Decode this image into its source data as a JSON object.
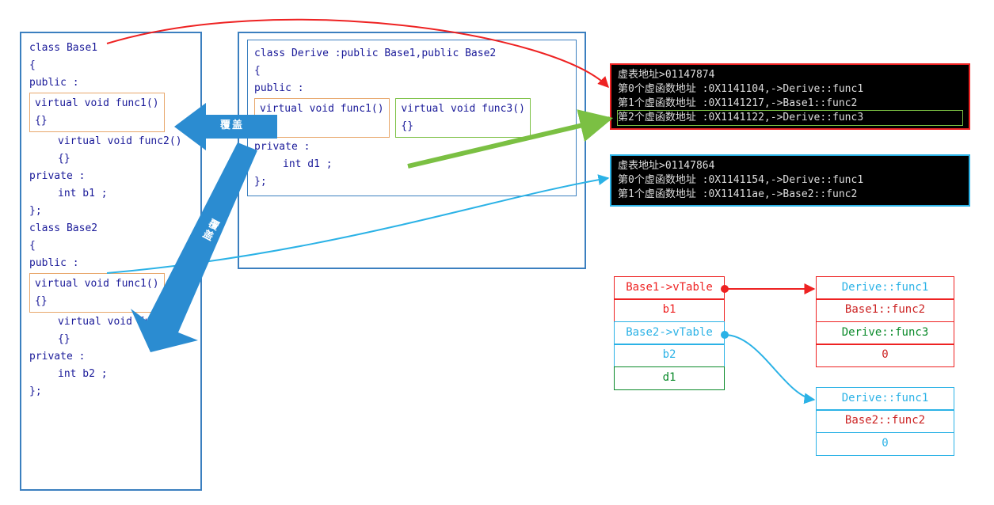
{
  "base_box": {
    "line1": "class Base1",
    "line2": "{",
    "line3": "public :",
    "func1": "virtual void func1()",
    "brace_pair": "{}",
    "func2": "virtual void func2()",
    "line_priv": "private :",
    "member_b1": "int b1 ;",
    "close": "};",
    "line_b2": "class Base2",
    "func1b": "virtual void func1()",
    "func2b": "virtual void func2()",
    "member_b2": "int b2 ;"
  },
  "derive_box": {
    "line1": "class Derive :public Base1,public Base2",
    "line2": "{",
    "line3": "public :",
    "func1": "virtual void func1()",
    "func3": "virtual void func3()",
    "brace_pair": "{}",
    "line_priv": "private :",
    "member_d1": "int d1 ;",
    "close": "};"
  },
  "console1": {
    "l1": "虚表地址>01147874",
    "l2": "第0个虚函数地址 :0X1141104,->Derive::func1",
    "l3": "第1个虚函数地址 :0X1141217,->Base1::func2",
    "l4": "第2个虚函数地址 :0X1141122,->Derive::func3"
  },
  "console2": {
    "l1": "虚表地址>01147864",
    "l2": "第0个虚函数地址 :0X1141154,->Derive::func1",
    "l3": "第1个虚函数地址 :0X11411ae,->Base2::func2"
  },
  "obj": {
    "r1": "Base1->vTable",
    "r2": "b1",
    "r3": "Base2->vTable",
    "r4": "b2",
    "r5": "d1"
  },
  "vt1": {
    "r1": "Derive::func1",
    "r2": "Base1::func2",
    "r3": "Derive::func3",
    "r4": "0"
  },
  "vt2": {
    "r1": "Derive::func1",
    "r2": "Base2::func2",
    "r3": "0"
  },
  "labels": {
    "override": "覆盖"
  }
}
